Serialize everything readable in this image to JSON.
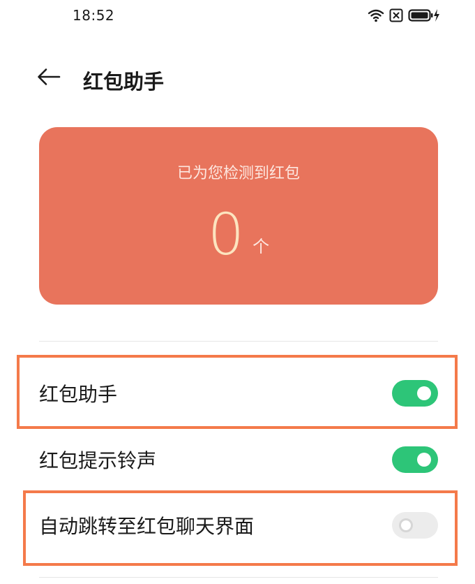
{
  "status_bar": {
    "time": "18:52",
    "icons": [
      "wifi-icon",
      "sim-disabled-icon",
      "battery-charging-icon"
    ]
  },
  "header": {
    "back_icon": "arrow-left-icon",
    "title": "红包助手"
  },
  "summary_card": {
    "label": "已为您检测到红包",
    "count": "0",
    "unit": "个",
    "background_color": "#e8745c",
    "count_color": "#fce4bf"
  },
  "settings": [
    {
      "label": "红包助手",
      "enabled": true,
      "highlighted": true
    },
    {
      "label": "红包提示铃声",
      "enabled": true,
      "highlighted": false
    },
    {
      "label": "自动跳转至红包聊天界面",
      "enabled": false,
      "highlighted": true
    }
  ],
  "colors": {
    "toggle_on": "#2dc578",
    "toggle_off": "#ececec",
    "highlight": "#f47a4a"
  }
}
